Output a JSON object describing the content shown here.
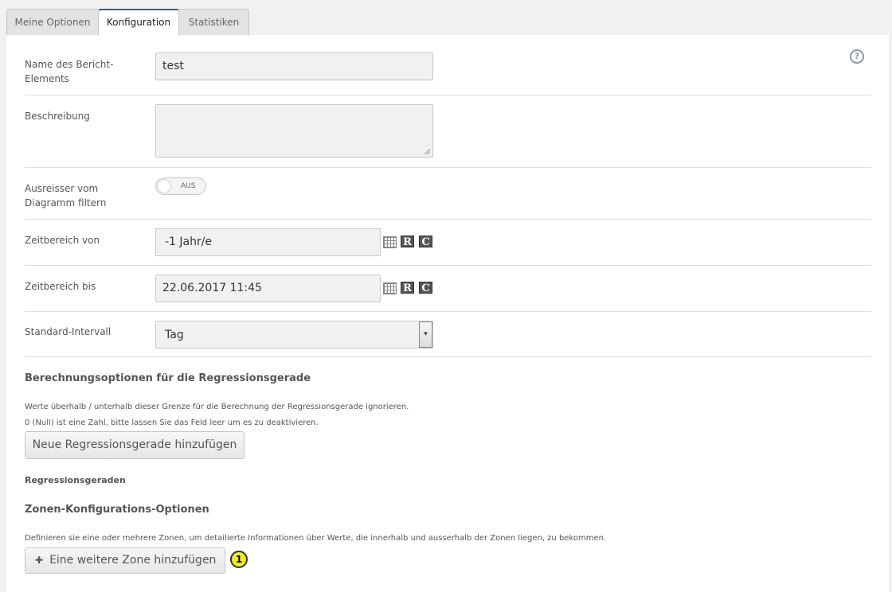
{
  "tabs": [
    {
      "label": "Meine Optionen"
    },
    {
      "label": "Konfiguration"
    },
    {
      "label": "Statistiken"
    }
  ],
  "help": {
    "glyph": "?"
  },
  "form": {
    "name": {
      "label": "Name des Bericht-Elements",
      "value": "test"
    },
    "description": {
      "label": "Beschreibung",
      "value": ""
    },
    "outliers": {
      "label": "Ausreisser vom Diagramm filtern",
      "state": "AUS"
    },
    "range_from": {
      "label": "Zeitbereich von",
      "value": "-1 Jahr/e"
    },
    "range_to": {
      "label": "Zeitbereich bis",
      "value": "22.06.2017 11:45"
    },
    "interval": {
      "label": "Standard-Intervall",
      "selected": "Tag"
    },
    "icon_r": "R",
    "icon_c": "C"
  },
  "regression": {
    "heading": "Berechnungsoptionen für die Regressionsgerade",
    "note1": "Werte überhalb / unterhalb dieser Grenze für die Berechnung der Regressionsgerade ignorieren.",
    "note2": "0 (Null) ist eine Zahl, bitte lassen Sie das Feld leer um es zu deaktivieren.",
    "add_button": "Neue Regressionsgerade hinzufügen",
    "list_heading": "Regressionsgeraden"
  },
  "zones": {
    "heading": "Zonen-Konfigurations-Optionen",
    "note": "Definieren sie eine oder mehrere Zonen, um detailierte Informationen über Werte, die innerhalb und ausserhalb der Zonen liegen, zu bekommen.",
    "add_button": "Eine weitere Zone hinzufügen",
    "plus": "✚"
  },
  "callout": {
    "number": "1",
    "color": "#f2ec1e"
  }
}
